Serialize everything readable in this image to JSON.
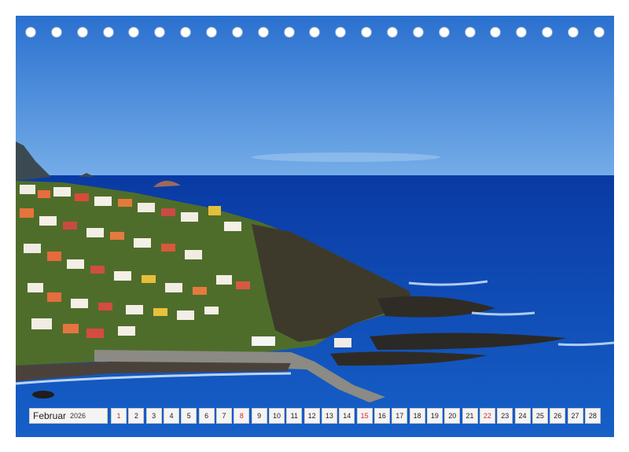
{
  "calendar": {
    "month": "Februar",
    "year": "2026",
    "days": [
      "1",
      "2",
      "3",
      "4",
      "5",
      "6",
      "7",
      "8",
      "9",
      "10",
      "11",
      "12",
      "13",
      "14",
      "15",
      "16",
      "17",
      "18",
      "19",
      "20",
      "21",
      "22",
      "23",
      "24",
      "25",
      "26",
      "27",
      "28"
    ],
    "sundays": [
      "1",
      "8",
      "15",
      "22"
    ]
  },
  "binding": {
    "hole_count": 23
  },
  "colors": {
    "sky_top": "#2f78d4",
    "sky_bottom": "#6aa6e6",
    "ocean_far": "#0b3fae",
    "ocean_near": "#1358c2",
    "cliff": "#3c3a2a",
    "vegetation": "#5b7a2c",
    "sunday_text": "#d62a2a"
  }
}
